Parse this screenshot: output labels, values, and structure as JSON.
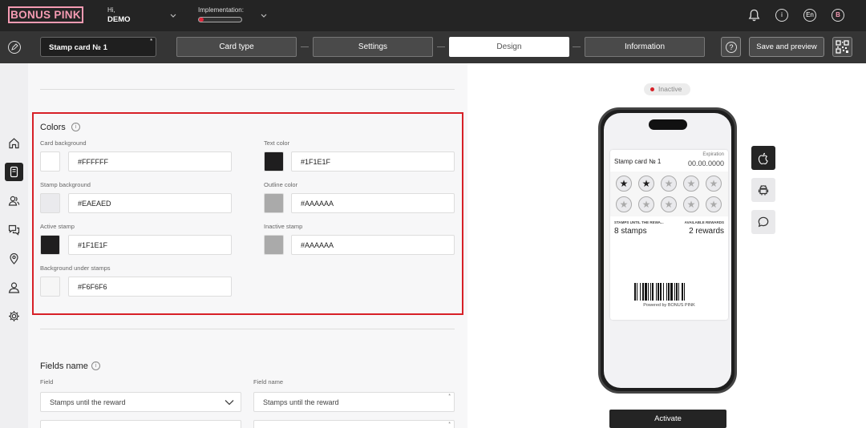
{
  "brand": {
    "logo_text": "BONUS PINK",
    "accent": "#f59bb3"
  },
  "header": {
    "greeting": "Hi,",
    "user_name": "DEMO",
    "implementation_label": "Implementation:",
    "implementation_progress": 0.12,
    "language": "En",
    "avatar_letter": "B",
    "icons": [
      "bell-icon",
      "info-icon",
      "language-icon",
      "avatar-icon"
    ]
  },
  "toolbar": {
    "card_name": "Stamp card № 1",
    "required_mark": "*",
    "steps": [
      {
        "label": "Card type",
        "active": false
      },
      {
        "label": "Settings",
        "active": false
      },
      {
        "label": "Design",
        "active": true
      },
      {
        "label": "Information",
        "active": false
      }
    ],
    "help_label": "?",
    "save_label": "Save and preview"
  },
  "sidebar": {
    "items": [
      "home-icon",
      "card-icon",
      "users-icon",
      "chat-icon",
      "location-icon",
      "profile-icon",
      "settings-icon"
    ],
    "active_index": 1
  },
  "colors_section": {
    "title": "Colors",
    "fields": [
      {
        "label": "Card background",
        "value": "#FFFFFF",
        "swatch": "#FFFFFF"
      },
      {
        "label": "Text color",
        "value": "#1F1E1F",
        "swatch": "#1F1E1F"
      },
      {
        "label": "Stamp background",
        "value": "#EAEAED",
        "swatch": "#EAEAED"
      },
      {
        "label": "Outline color",
        "value": "#AAAAAA",
        "swatch": "#AAAAAA"
      },
      {
        "label": "Active stamp",
        "value": "#1F1E1F",
        "swatch": "#1F1E1F"
      },
      {
        "label": "Inactive stamp",
        "value": "#AAAAAA",
        "swatch": "#AAAAAA"
      },
      {
        "label": "Background under stamps",
        "value": "#F6F6F6",
        "swatch": "#F6F6F6"
      }
    ]
  },
  "fields_section": {
    "title": "Fields name",
    "col_field": "Field",
    "col_field_name": "Field name",
    "rows": [
      {
        "field": "Stamps until the reward",
        "name": "Stamps until the reward"
      }
    ]
  },
  "preview": {
    "status": "Inactive",
    "status_color": "#d72027",
    "card_title": "Stamp card № 1",
    "expiration_label": "Expiration",
    "expiration_value": "00.00.0000",
    "stamps_total": 10,
    "stamps_active": 2,
    "left_label": "STAMPS UNTIL THE REWA...",
    "left_value": "8 stamps",
    "right_label": "AVAILABLE REWARDS",
    "right_value": "2 rewards",
    "powered": "Powered by BONUS PINK",
    "platforms": [
      "apple-icon",
      "android-icon",
      "message-icon"
    ],
    "activate_label": "Activate"
  }
}
